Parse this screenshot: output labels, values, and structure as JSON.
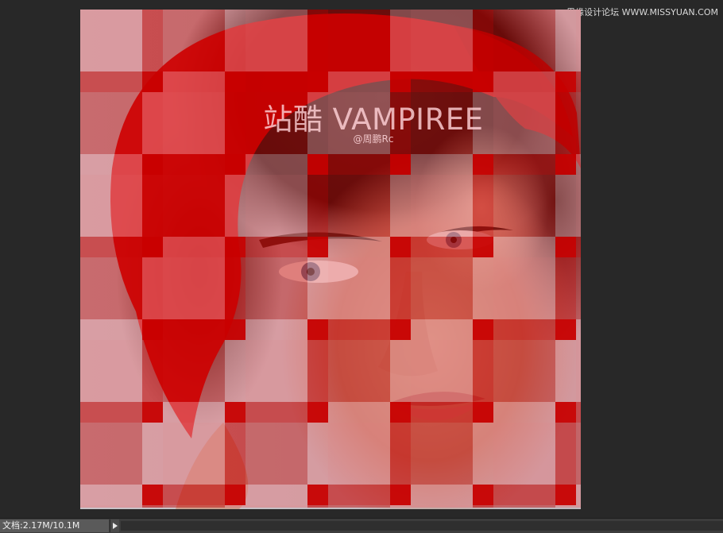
{
  "watermark": {
    "text": "思缘设计论坛 WWW.MISSYUAN.COM"
  },
  "canvas": {
    "title": "站酷 VAMPIREE",
    "subtitle": "@周鹏Rc"
  },
  "statusbar": {
    "doc_info": "文档:2.17M/10.1M",
    "arrow_icon": "triangle-right-icon"
  },
  "colors": {
    "workspace": "#282828",
    "mosaic_red": "#c80000",
    "mosaic_pink": "#e87a80"
  }
}
